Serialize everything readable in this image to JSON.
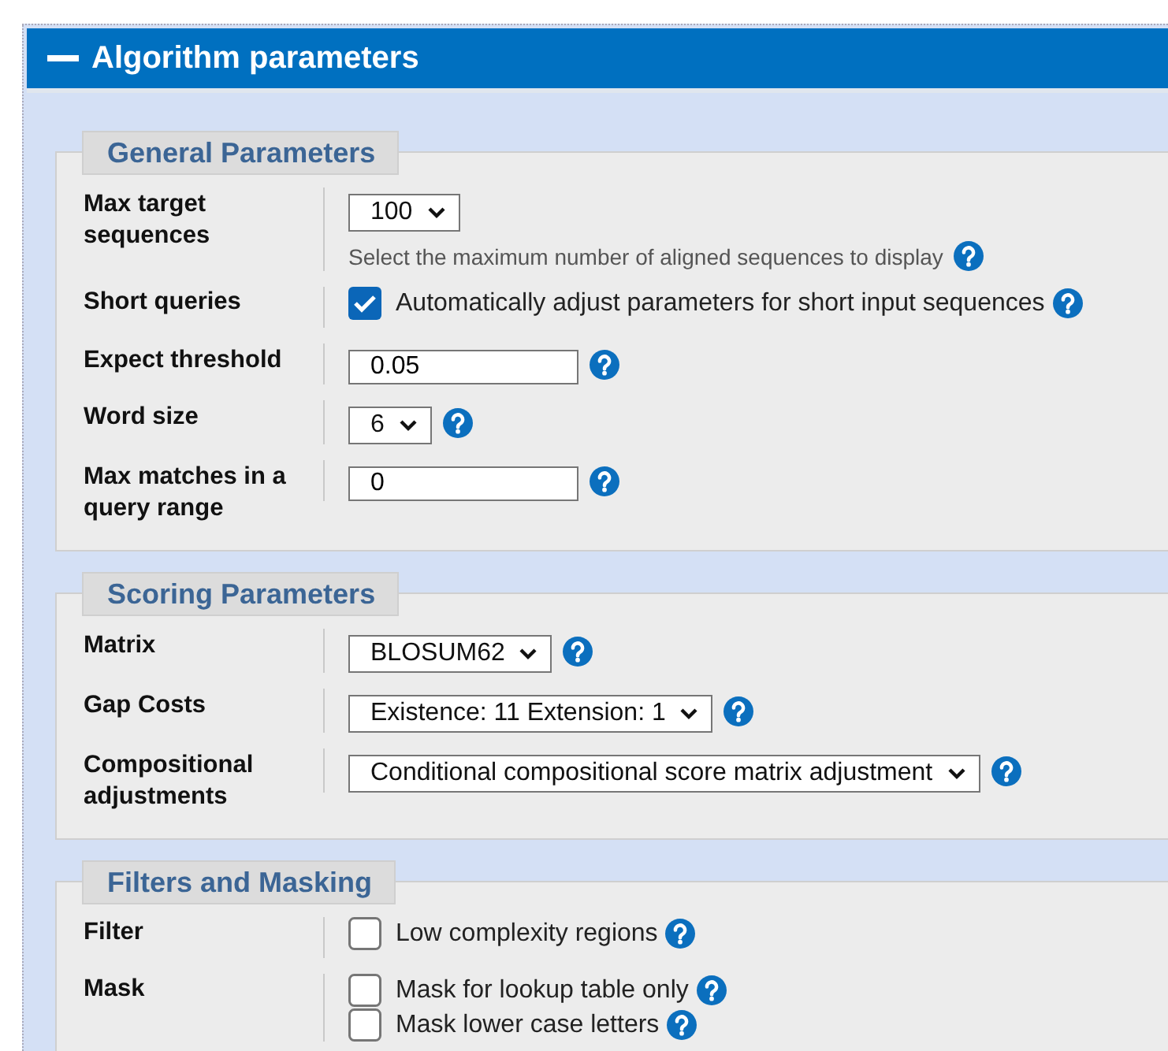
{
  "panel": {
    "title": "Algorithm parameters",
    "expanded": true
  },
  "sections": [
    {
      "legend": "General Parameters",
      "rows": [
        {
          "label": "Max target sequences",
          "kind": "select",
          "value": "100",
          "hint": "Select the maximum number of aligned sequences to display",
          "help": true
        },
        {
          "label": "Short queries",
          "kind": "checkbox",
          "options": [
            {
              "label": "Automatically adjust parameters for short input sequences",
              "checked": true,
              "help": true
            }
          ]
        },
        {
          "label": "Expect threshold",
          "kind": "text",
          "value": "0.05",
          "help": true
        },
        {
          "label": "Word size",
          "kind": "select",
          "value": "6",
          "help": true
        },
        {
          "label": "Max matches in a query range",
          "kind": "text",
          "value": "0",
          "help": true
        }
      ]
    },
    {
      "legend": "Scoring Parameters",
      "rows": [
        {
          "label": "Matrix",
          "kind": "select",
          "value": "BLOSUM62",
          "help": true
        },
        {
          "label": "Gap Costs",
          "kind": "select",
          "value": "Existence: 11 Extension: 1",
          "help": true
        },
        {
          "label": "Compositional adjustments",
          "kind": "select",
          "value": "Conditional compositional score matrix adjustment",
          "help": true
        }
      ]
    },
    {
      "legend": "Filters and Masking",
      "rows": [
        {
          "label": "Filter",
          "kind": "checkbox",
          "options": [
            {
              "label": "Low complexity regions",
              "checked": false,
              "help": true
            }
          ]
        },
        {
          "label": "Mask",
          "kind": "checkbox",
          "options": [
            {
              "label": "Mask for lookup table only",
              "checked": false,
              "help": true
            },
            {
              "label": "Mask lower case letters",
              "checked": false,
              "help": true
            }
          ]
        }
      ]
    }
  ]
}
